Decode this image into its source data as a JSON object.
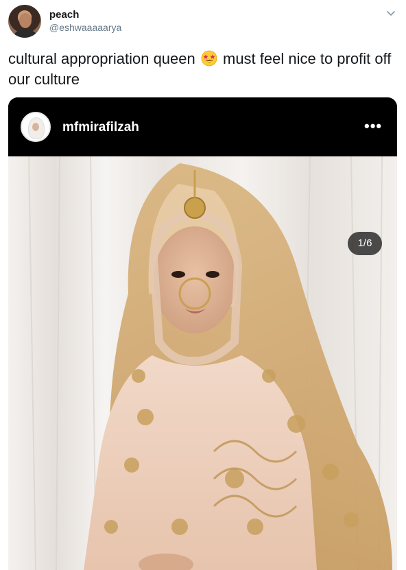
{
  "tweet": {
    "display_name": "peach",
    "handle": "@eshwaaaaarya",
    "text_part1": "cultural appropriation queen",
    "emoji": "star-struck-emoji",
    "text_part2": "must feel nice to profit off our culture",
    "menu_icon": "chevron-down-icon"
  },
  "embedded_post": {
    "username": "mfmirafilzah",
    "more_icon": "more-dots-icon",
    "counter": "1/6",
    "photo_subject": "bridal-portrait-image"
  },
  "colors": {
    "text": "#14171a",
    "secondary_text": "#657786",
    "ig_bar": "#000000",
    "counter_bg": "#262626"
  }
}
